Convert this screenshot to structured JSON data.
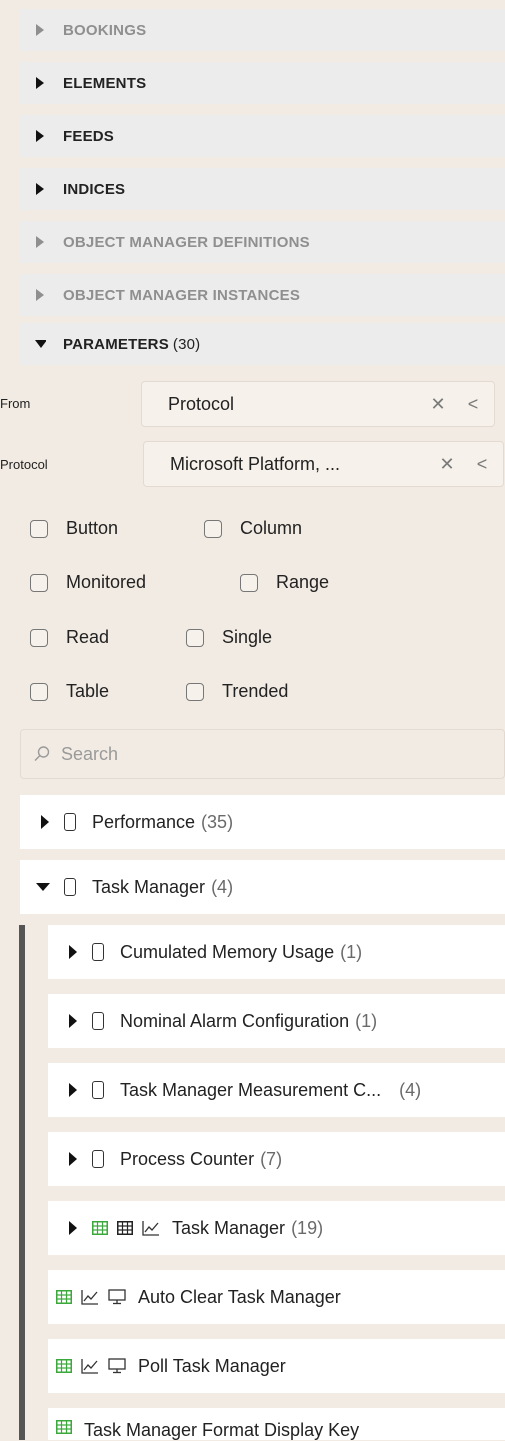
{
  "sections": [
    {
      "label": "BOOKINGS",
      "state": "collapsed",
      "disabled": true
    },
    {
      "label": "ELEMENTS",
      "state": "collapsed",
      "disabled": false
    },
    {
      "label": "FEEDS",
      "state": "collapsed",
      "disabled": false
    },
    {
      "label": "INDICES",
      "state": "collapsed",
      "disabled": false
    },
    {
      "label": "OBJECT MANAGER DEFINITIONS",
      "state": "collapsed",
      "disabled": true
    },
    {
      "label": "OBJECT MANAGER INSTANCES",
      "state": "collapsed",
      "disabled": true
    },
    {
      "label": "PARAMETERS",
      "count": "(30)",
      "state": "expanded",
      "disabled": false
    }
  ],
  "filters": {
    "from": {
      "label": "From",
      "value": "Protocol"
    },
    "protocol": {
      "label": "Protocol",
      "value": "Microsoft Platform, ..."
    },
    "clear_glyph": "✕",
    "collapse_glyph": "<"
  },
  "checkboxes": [
    "Button",
    "Column",
    "Monitored",
    "Range",
    "Read",
    "Single",
    "Table",
    "Trended"
  ],
  "search": {
    "placeholder": "Search"
  },
  "tree": [
    {
      "label": "Performance",
      "count": "(35)",
      "state": "collapsed",
      "level": 0,
      "icons": [
        "folder-icon"
      ]
    },
    {
      "label": "Task Manager",
      "count": "(4)",
      "state": "expanded",
      "level": 0,
      "icons": [
        "folder-icon"
      ]
    },
    {
      "label": "Cumulated Memory Usage",
      "count": "(1)",
      "state": "collapsed",
      "level": 1,
      "icons": [
        "folder-icon"
      ]
    },
    {
      "label": "Nominal Alarm Configuration",
      "count": "(1)",
      "state": "collapsed",
      "level": 1,
      "icons": [
        "folder-icon"
      ]
    },
    {
      "label": "Task Manager Measurement C...",
      "count": "(4)",
      "state": "collapsed",
      "level": 1,
      "icons": [
        "folder-icon"
      ]
    },
    {
      "label": "Process Counter",
      "count": "(7)",
      "state": "collapsed",
      "level": 1,
      "icons": [
        "folder-icon"
      ]
    },
    {
      "label": "Task Manager",
      "count": "(19)",
      "state": "collapsed",
      "level": 1,
      "icons": [
        "green-table-icon",
        "table-icon",
        "trend-icon"
      ]
    },
    {
      "label": "Auto Clear Task Manager",
      "count": "",
      "state": "leaf",
      "level": 1,
      "icons": [
        "green-table-icon",
        "trend-icon",
        "monitor-icon"
      ]
    },
    {
      "label": "Poll Task Manager",
      "count": "",
      "state": "leaf",
      "level": 1,
      "icons": [
        "green-table-icon",
        "trend-icon",
        "monitor-icon"
      ]
    },
    {
      "label": "Task Manager Format Display Key",
      "count": "",
      "state": "leaf",
      "level": 1,
      "icons": [
        "green-table-icon"
      ]
    }
  ],
  "colors": {
    "background": "#f2ebe3",
    "section_bg": "#ececec",
    "green_icon": "#3aa83a",
    "tree_line": "#555555"
  }
}
